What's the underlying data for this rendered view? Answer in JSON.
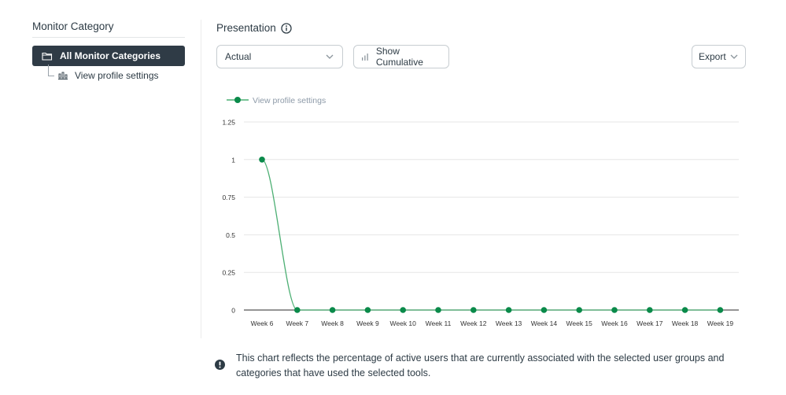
{
  "sidebar": {
    "title": "Monitor Category",
    "all_label": "All Monitor Categories",
    "all_icon": "folder-icon",
    "children": [
      {
        "label": "View profile settings",
        "icon": "bar-chart-icon"
      }
    ]
  },
  "presentation": {
    "title": "Presentation",
    "title_icon": "info-icon",
    "select_value": "Actual",
    "cumulative_label": "Show Cumulative",
    "export_label": "Export"
  },
  "colors": {
    "accent_green": "#0a8a4a",
    "line_green": "#4caf73",
    "sidebar_active_bg": "#2f3b46"
  },
  "chart_data": {
    "type": "line",
    "title": "",
    "xlabel": "",
    "ylabel": "",
    "categories": [
      "Week 6",
      "Week 7",
      "Week 8",
      "Week 9",
      "Week 10",
      "Week 11",
      "Week 12",
      "Week 13",
      "Week 14",
      "Week 15",
      "Week 16",
      "Week 17",
      "Week 18",
      "Week 19"
    ],
    "series": [
      {
        "name": "View profile settings",
        "values": [
          1,
          0,
          0,
          0,
          0,
          0,
          0,
          0,
          0,
          0,
          0,
          0,
          0,
          0
        ]
      }
    ],
    "y_ticks": [
      "0",
      "0.25",
      "0.5",
      "0.75",
      "1",
      "1.25"
    ],
    "ylim": [
      0,
      1.25
    ],
    "grid": true,
    "legend": "top-left"
  },
  "note": {
    "icon": "alert-icon",
    "text": "This chart reflects the percentage of active users that are currently associated with the selected user groups and categories that have used the selected tools."
  }
}
